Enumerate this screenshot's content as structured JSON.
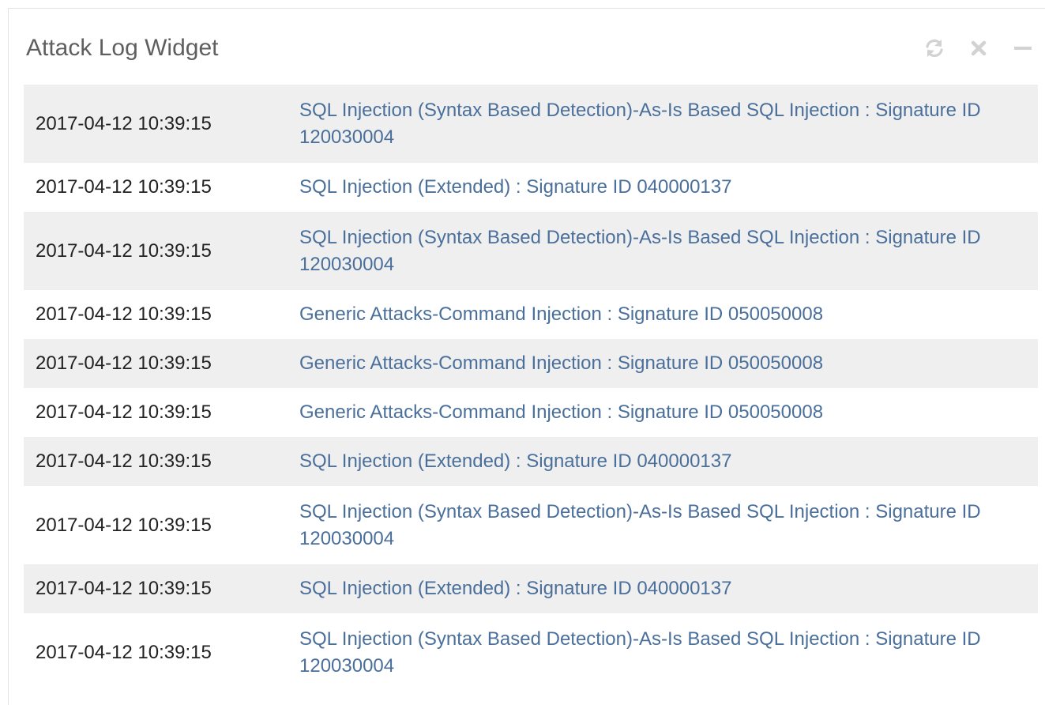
{
  "widget": {
    "title": "Attack Log Widget",
    "controls": [
      {
        "name": "refresh-icon",
        "label": "refresh"
      },
      {
        "name": "close-icon",
        "label": "close"
      },
      {
        "name": "minimize-icon",
        "label": "minimize"
      }
    ]
  },
  "colors": {
    "title": "#5f5f5f",
    "link": "#4a6f9b",
    "stripe": "#efefef",
    "icon": "#d2d2d2"
  },
  "logs": [
    {
      "time": "2017-04-12 10:39:15",
      "message": "SQL Injection (Syntax Based Detection)-As-Is Based SQL Injection : Signature ID 120030004"
    },
    {
      "time": "2017-04-12 10:39:15",
      "message": "SQL Injection (Extended) : Signature ID 040000137"
    },
    {
      "time": "2017-04-12 10:39:15",
      "message": "SQL Injection (Syntax Based Detection)-As-Is Based SQL Injection : Signature ID 120030004"
    },
    {
      "time": "2017-04-12 10:39:15",
      "message": "Generic Attacks-Command Injection : Signature ID 050050008"
    },
    {
      "time": "2017-04-12 10:39:15",
      "message": "Generic Attacks-Command Injection : Signature ID 050050008"
    },
    {
      "time": "2017-04-12 10:39:15",
      "message": "Generic Attacks-Command Injection : Signature ID 050050008"
    },
    {
      "time": "2017-04-12 10:39:15",
      "message": "SQL Injection (Extended) : Signature ID 040000137"
    },
    {
      "time": "2017-04-12 10:39:15",
      "message": "SQL Injection (Syntax Based Detection)-As-Is Based SQL Injection : Signature ID 120030004"
    },
    {
      "time": "2017-04-12 10:39:15",
      "message": "SQL Injection (Extended) : Signature ID 040000137"
    },
    {
      "time": "2017-04-12 10:39:15",
      "message": "SQL Injection (Syntax Based Detection)-As-Is Based SQL Injection : Signature ID 120030004"
    }
  ]
}
